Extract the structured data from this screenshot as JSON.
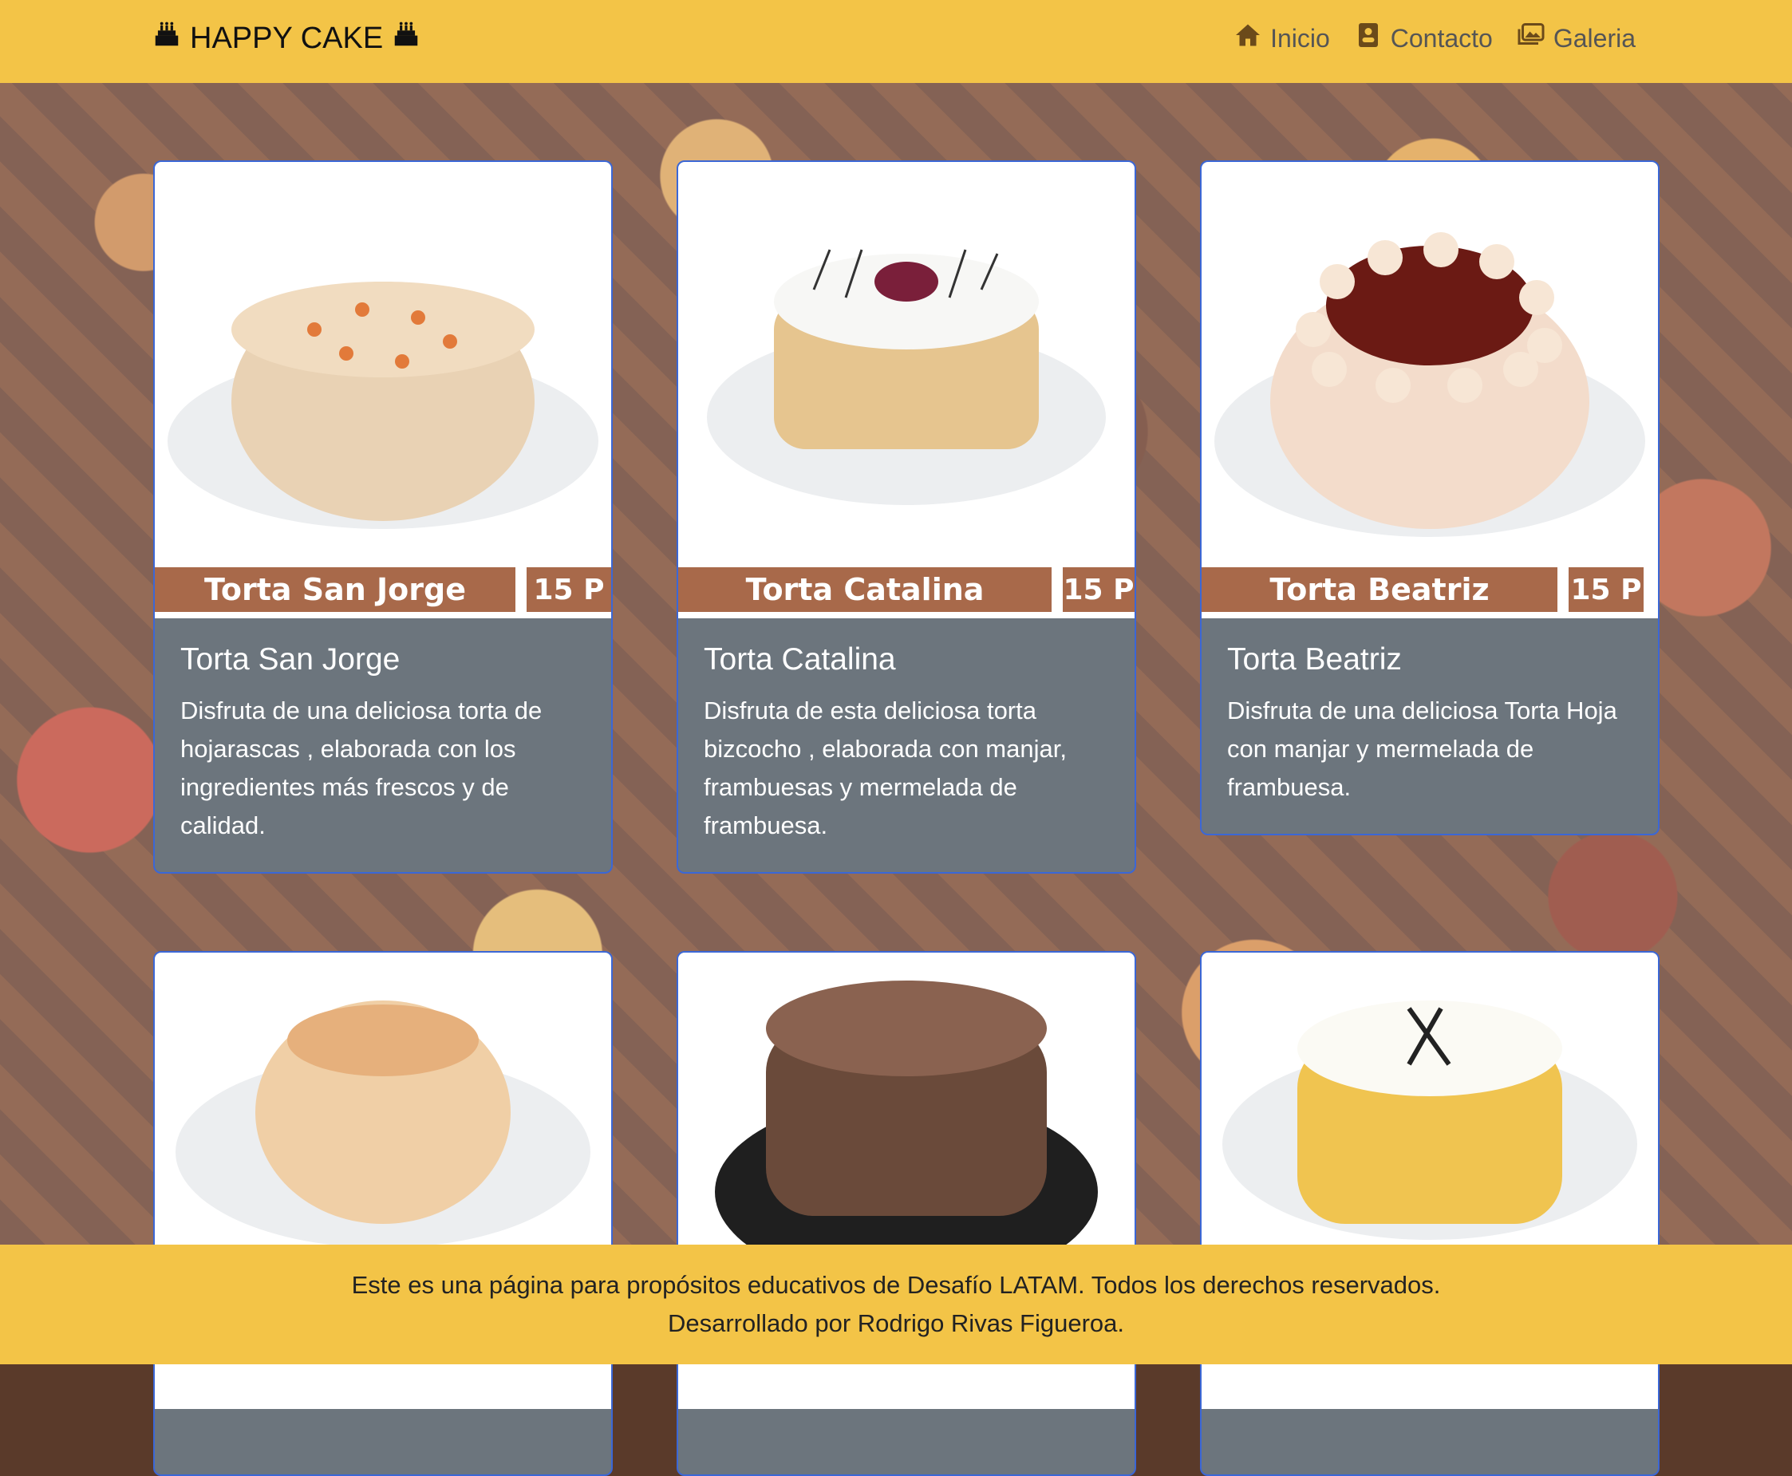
{
  "navbar": {
    "brand": "HAPPY CAKE",
    "links": [
      {
        "label": "Inicio",
        "icon": "house-icon"
      },
      {
        "label": "Contacto",
        "icon": "contact-card-icon"
      },
      {
        "label": "Galeria",
        "icon": "images-icon"
      }
    ]
  },
  "cards": [
    {
      "title": "Torta San Jorge",
      "description": "Disfruta de una deliciosa torta de hojarascas , elaborada con los ingredientes más frescos y de calidad.",
      "image_label": "Torta San Jorge",
      "image_price": "15 P"
    },
    {
      "title": "Torta Catalina",
      "description": "Disfruta de esta deliciosa torta bizcocho , elaborada con manjar, frambuesas y mermelada de frambuesa.",
      "image_label": "Torta Catalina",
      "image_price": "15 P"
    },
    {
      "title": "Torta Beatriz",
      "description": "Disfruta de una deliciosa Torta Hoja con manjar y mermelada de frambuesa.",
      "image_label": "Torta Beatriz",
      "image_price": "15 P"
    },
    {
      "title": "",
      "description": ""
    },
    {
      "title": "",
      "description": ""
    },
    {
      "title": "",
      "description": ""
    }
  ],
  "footer": {
    "line1": "Este es una página para propósitos educativos de Desafío LATAM. Todos los derechos reservados.",
    "line2": "Desarrollado por Rodrigo Rivas Figueroa."
  },
  "colors": {
    "navbar_bg": "#f3c447",
    "card_body": "#6c757d",
    "card_border": "#3b67d6",
    "label_bg": "#a8694a"
  }
}
